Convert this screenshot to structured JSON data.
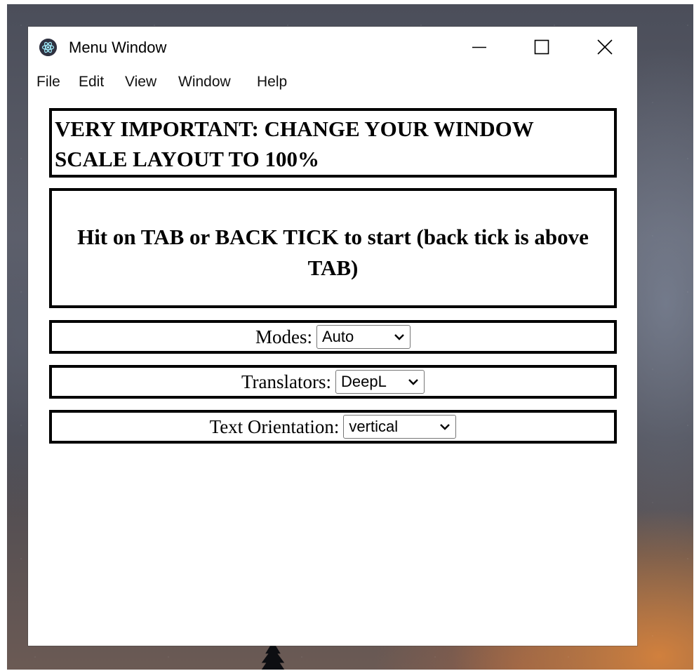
{
  "window": {
    "title": "Menu Window"
  },
  "menubar": {
    "items": [
      "File",
      "Edit",
      "View",
      "Window",
      "Help"
    ]
  },
  "content": {
    "important_notice": "VERY IMPORTANT: CHANGE YOUR WINDOW SCALE LAYOUT TO 100%",
    "start_hint": "Hit on TAB or BACK TICK to start (back tick is above TAB)",
    "modes": {
      "label": "Modes:",
      "selected": "Auto"
    },
    "translators": {
      "label": "Translators:",
      "selected": "DeepL"
    },
    "text_orientation": {
      "label": "Text Orientation:",
      "selected": "vertical"
    }
  },
  "icons": {
    "app": "electron-app-icon",
    "minimize": "minimize-icon",
    "maximize": "maximize-icon",
    "close": "close-icon",
    "dropdown": "chevron-down-icon"
  },
  "colors": {
    "window_background": "#ffffff",
    "border": "#000000",
    "text": "#000000"
  }
}
